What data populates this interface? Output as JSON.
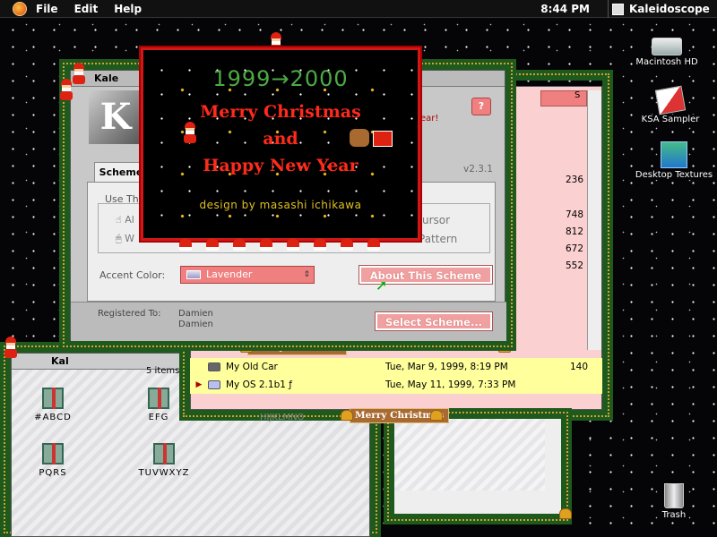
{
  "menubar": {
    "file": "File",
    "edit": "Edit",
    "help": "Help",
    "clock": "8:44 PM",
    "app": "Kaleidoscope"
  },
  "desktop": {
    "hd": "Macintosh HD",
    "ksa": "KSA Sampler",
    "textures": "Desktop Textures",
    "trash": "Trash"
  },
  "splash": {
    "years": "1999→2000",
    "line1": "Merry Christmas",
    "line2": "and",
    "line3": "Happy New Year",
    "credit": "design by masashi ichikawa"
  },
  "control_panel": {
    "title": "Kale",
    "tab": "Scheme",
    "use_the": "Use Th",
    "version": "v2.3.1",
    "greeting_tail": "ear!",
    "al": "Al",
    "w": "W",
    "ursor": "ursor",
    "pattern": "Pattern",
    "accent_label": "Accent Color:",
    "accent_value": "Lavender",
    "about_btn": "About This Scheme",
    "registered_label": "Registered To:",
    "reg_name1": "Damien",
    "reg_name2": "Damien",
    "select_btn": "Select Scheme..."
  },
  "list_window": {
    "banner": "Merry Christmas",
    "col_s": "S",
    "left_frag_m1": "M",
    "left_frag_m2": "M",
    "sizes": [
      "236",
      "748",
      "812",
      "672",
      "552",
      "140"
    ],
    "rows": [
      {
        "name": "My Old Car",
        "date": "Tue, Mar 9, 1999, 8:19 PM"
      },
      {
        "name": "My OS 2.1b1 ƒ",
        "date": "Tue, May 11, 1999, 7:33 PM"
      }
    ]
  },
  "folder_window": {
    "title": "Kal",
    "count": "5 items",
    "banner": "Merry Christmas",
    "icons": [
      "#ABCD",
      "EFG",
      "PQRS",
      "TUVWXYZ"
    ],
    "partial": "HIJKLMNO"
  },
  "colors": {
    "pink": "#fbd0d0",
    "yellow": "#ffff9c",
    "accent_red": "#f08080",
    "garland": "#1e5a1e"
  }
}
